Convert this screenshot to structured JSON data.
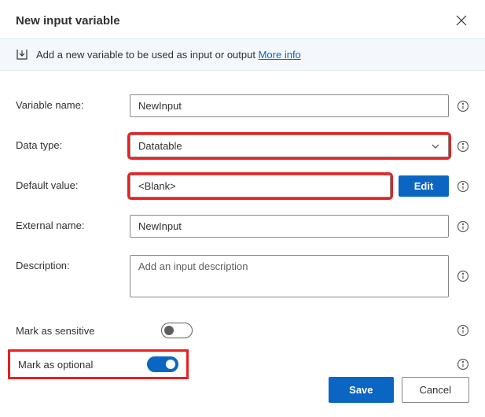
{
  "dialog": {
    "title": "New input variable"
  },
  "infobar": {
    "text": "Add a new variable to be used as input or output",
    "link_text": "More info"
  },
  "labels": {
    "variable_name": "Variable name:",
    "data_type": "Data type:",
    "default_value": "Default value:",
    "external_name": "External name:",
    "description": "Description:",
    "mark_sensitive": "Mark as sensitive",
    "mark_optional": "Mark as optional"
  },
  "values": {
    "variable_name": "NewInput",
    "data_type": "Datatable",
    "default_value": "<Blank>",
    "external_name": "NewInput",
    "description_placeholder": "Add an input description"
  },
  "buttons": {
    "edit": "Edit",
    "save": "Save",
    "cancel": "Cancel"
  },
  "toggles": {
    "sensitive_on": false,
    "optional_on": true
  }
}
